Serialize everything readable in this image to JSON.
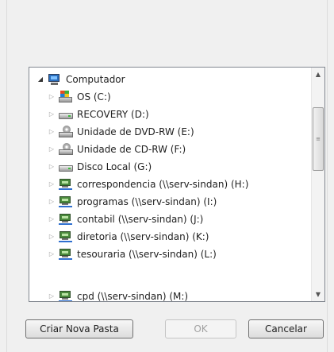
{
  "tree": {
    "items": [
      {
        "label": "Computador",
        "icon": "computer-icon",
        "expanded": true
      },
      {
        "label": "OS (C:)",
        "icon": "os-drive-icon"
      },
      {
        "label": "RECOVERY (D:)",
        "icon": "drive-icon"
      },
      {
        "label": "Unidade de DVD-RW (E:)",
        "icon": "dvd-drive-icon"
      },
      {
        "label": "Unidade de CD-RW (F:)",
        "icon": "cd-drive-icon"
      },
      {
        "label": "Disco Local (G:)",
        "icon": "drive-icon"
      },
      {
        "label": "correspondencia (\\\\serv-sindan) (H:)",
        "icon": "network-drive-icon"
      },
      {
        "label": "programas (\\\\serv-sindan) (I:)",
        "icon": "network-drive-icon"
      },
      {
        "label": "contabil (\\\\serv-sindan) (J:)",
        "icon": "network-drive-icon"
      },
      {
        "label": "diretoria (\\\\serv-sindan) (K:)",
        "icon": "network-drive-icon"
      },
      {
        "label": "tesouraria (\\\\serv-sindan) (L:)",
        "icon": "network-drive-icon"
      },
      {
        "label": "cpd (\\\\serv-sindan) (M:)",
        "icon": "network-drive-icon"
      }
    ]
  },
  "buttons": {
    "new_folder": "Criar Nova Pasta",
    "ok": "OK",
    "cancel": "Cancelar"
  },
  "colors": {
    "dialog_bg": "#f0f0f0",
    "tree_border": "#828790"
  }
}
